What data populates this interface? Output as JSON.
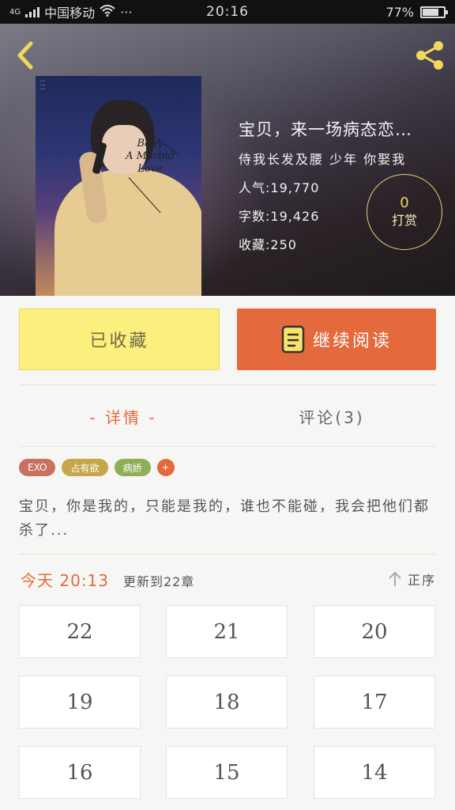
{
  "status_bar": {
    "network": "4G",
    "carrier": "中国移动",
    "dots": "···",
    "time": "20:16",
    "battery": "77%",
    "battery_level": 0.77
  },
  "header": {
    "back_icon": "chevron-left-icon",
    "share_icon": "share-icon"
  },
  "book": {
    "title": "宝贝，来一场病态恋…",
    "author": "侍我长发及腰 少年 你娶我",
    "popularity": "人气:19,770",
    "word_count": "字数:19,426",
    "favorites": "收藏:250",
    "cover_text": [
      "Baby",
      "A Morbid",
      "Love"
    ]
  },
  "reward": {
    "count": "0",
    "label": "打赏"
  },
  "actions": {
    "favorite_label": "已收藏",
    "read_label": "继续阅读"
  },
  "tabs": {
    "detail": "- 详情 -",
    "comments": "评论(3)"
  },
  "tags": [
    {
      "label": "EXO",
      "color": "#c97060"
    },
    {
      "label": "占有欲",
      "color": "#c7a54a"
    },
    {
      "label": "病娇",
      "color": "#8fae5a"
    },
    {
      "label": "+",
      "color": "#e4693c"
    }
  ],
  "summary": "宝贝，你是我的，只能是我的，谁也不能碰，我会把他们都杀了...",
  "update": {
    "time": "今天 20:13",
    "text": "更新到22章",
    "sort_label": "正序"
  },
  "chapters": [
    "22",
    "21",
    "20",
    "19",
    "18",
    "17",
    "16",
    "15",
    "14"
  ],
  "colors": {
    "accent": "#e4693c",
    "favorite_bg": "#fbf07d",
    "reward_ring": "#e6d27a"
  }
}
